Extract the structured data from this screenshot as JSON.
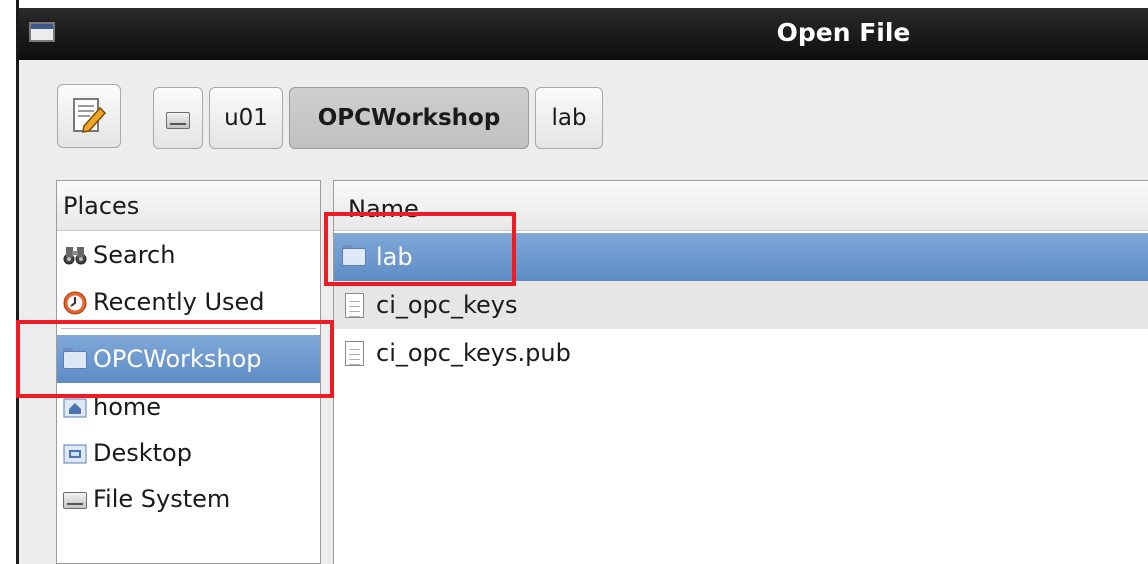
{
  "window": {
    "title": "Open File"
  },
  "pathbar": {
    "crumbs": [
      "u01",
      "OPCWorkshop",
      "lab"
    ],
    "active_crumb": "OPCWorkshop"
  },
  "places": {
    "header": "Places",
    "items": [
      {
        "label": "Search",
        "icon": "binoculars-icon"
      },
      {
        "label": "Recently Used",
        "icon": "clock-icon"
      },
      {
        "label": "OPCWorkshop",
        "icon": "folder-icon",
        "selected": true
      },
      {
        "label": "home",
        "icon": "home-folder-icon"
      },
      {
        "label": "Desktop",
        "icon": "desktop-folder-icon"
      },
      {
        "label": "File System",
        "icon": "drive-icon"
      }
    ]
  },
  "files": {
    "header": "Name",
    "rows": [
      {
        "name": "lab",
        "icon": "folder-icon",
        "selected": true
      },
      {
        "name": "ci_opc_keys",
        "icon": "document-icon"
      },
      {
        "name": "ci_opc_keys.pub",
        "icon": "document-icon"
      }
    ]
  },
  "colors": {
    "highlight": "#ee1c25",
    "selection": "#6f9ad0",
    "titlebar": "#1a1a1a"
  }
}
